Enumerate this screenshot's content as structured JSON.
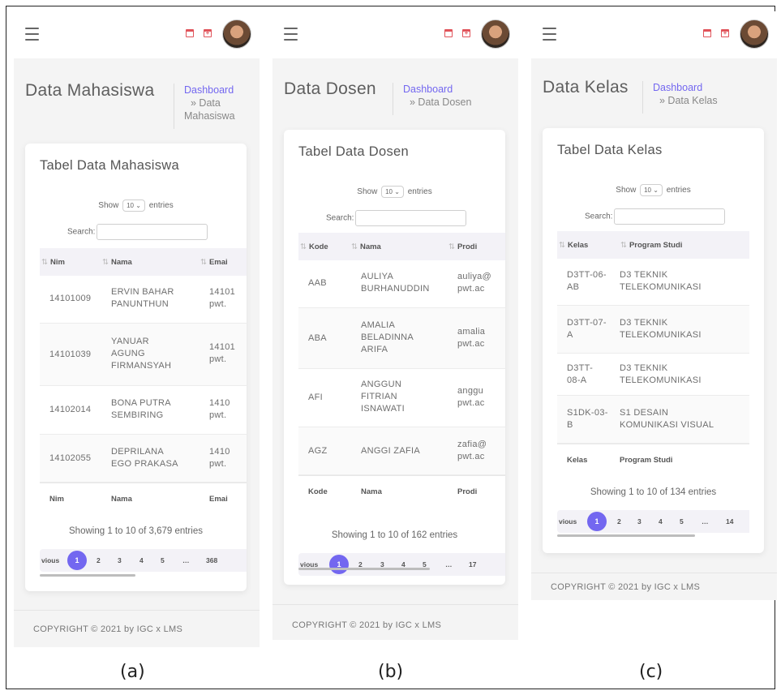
{
  "copyright": "COPYRIGHT © 2021 by IGC x LMS",
  "show_label": "Show",
  "entries_label": "entries",
  "page_size": "10",
  "search_label": "Search:",
  "breadcrumb_home": "Dashboard",
  "pager": {
    "prev": "vious",
    "pages": [
      "1",
      "2",
      "3",
      "4",
      "5",
      "…"
    ]
  },
  "colors": {
    "accent": "#7367f0",
    "calendar_icon": "#e0535a",
    "panel_bg": "#f4f4f4"
  },
  "icons": [
    "menu-icon",
    "calendar-icon",
    "calendar-plus-icon",
    "user-avatar"
  ],
  "panels": {
    "a": {
      "caption": "(a)",
      "title": "Data Mahasiswa",
      "crumb": [
        "» Data",
        "Mahasiswa"
      ],
      "card_title": "Tabel Data Mahasiswa",
      "columns": [
        "Nim",
        "Nama",
        "Emai"
      ],
      "rows": [
        {
          "c1": [
            "14101009"
          ],
          "c2": [
            "ERVIN BAHAR",
            "PANUNTHUN"
          ],
          "c3": [
            "14101",
            "pwt."
          ]
        },
        {
          "c1": [
            "14101039"
          ],
          "c2": [
            "YANUAR",
            "AGUNG",
            "FIRMANSYAH"
          ],
          "c3": [
            "14101",
            "pwt."
          ]
        },
        {
          "c1": [
            "14102014"
          ],
          "c2": [
            "BONA PUTRA",
            "SEMBIRING"
          ],
          "c3": [
            "1410",
            "pwt."
          ]
        },
        {
          "c1": [
            "14102055"
          ],
          "c2": [
            "DEPRILANA",
            "EGO PRAKASA"
          ],
          "c3": [
            "1410",
            "pwt."
          ]
        }
      ],
      "showing": "Showing 1 to 10 of 3,679 entries",
      "last_page": "368"
    },
    "b": {
      "caption": "(b)",
      "title": "Data Dosen",
      "crumb": [
        "» Data Dosen"
      ],
      "card_title": "Tabel Data Dosen",
      "columns": [
        "Kode",
        "Nama",
        "Prodi"
      ],
      "rows": [
        {
          "c1": [
            "AAB"
          ],
          "c2": [
            "AULIYA",
            "BURHANUDDIN"
          ],
          "c3": [
            "auliya@",
            "pwt.ac"
          ]
        },
        {
          "c1": [
            "ABA"
          ],
          "c2": [
            "AMALIA",
            "BELADINNA",
            "ARIFA"
          ],
          "c3": [
            "amalia",
            "pwt.ac"
          ]
        },
        {
          "c1": [
            "AFI"
          ],
          "c2": [
            "ANGGUN",
            "FITRIAN",
            "ISNAWATI"
          ],
          "c3": [
            "anggu",
            "pwt.ac"
          ]
        },
        {
          "c1": [
            "AGZ"
          ],
          "c2": [
            "ANGGI ZAFIA"
          ],
          "c3": [
            "zafia@",
            "pwt.ac"
          ]
        }
      ],
      "showing": "Showing 1 to 10 of 162 entries",
      "last_page": "17"
    },
    "c": {
      "caption": "(c)",
      "title": "Data Kelas",
      "crumb": [
        "» Data Kelas"
      ],
      "card_title": "Tabel Data Kelas",
      "columns": [
        "Kelas",
        "Program Studi"
      ],
      "rows": [
        {
          "c1": [
            "D3TT-06-",
            "AB"
          ],
          "c2": [
            "D3 TEKNIK",
            "TELEKOMUNIKASI"
          ]
        },
        {
          "c1": [
            "D3TT-07-",
            "A"
          ],
          "c2": [
            "D3 TEKNIK",
            "TELEKOMUNIKASI"
          ]
        },
        {
          "c1": [
            "D3TT-",
            "08-A"
          ],
          "c2": [
            "D3 TEKNIK",
            "TELEKOMUNIKASI"
          ]
        },
        {
          "c1": [
            "S1DK-03-",
            "B"
          ],
          "c2": [
            "S1 DESAIN",
            "KOMUNIKASI VISUAL"
          ]
        }
      ],
      "showing": "Showing 1 to 10 of 134 entries",
      "last_page": "14"
    }
  }
}
